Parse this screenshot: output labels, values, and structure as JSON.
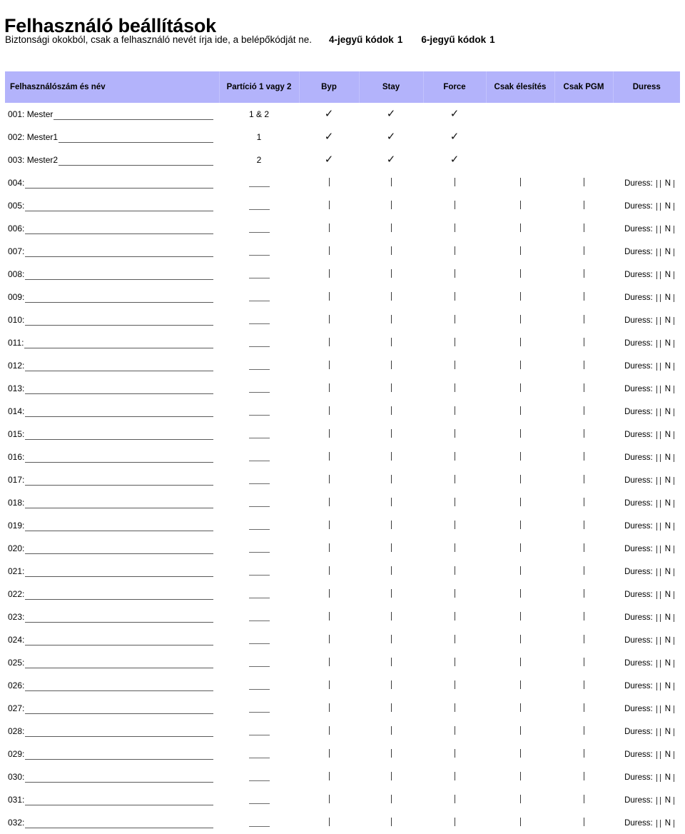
{
  "page": {
    "title": "Felhasználó beállítások",
    "note": "Biztonsági okokból, csak a felhasználó nevét írja ide, a belépőkódját ne.",
    "code4_label": "4-jegyű kódok",
    "code4_value": "1",
    "code6_label": "6-jegyű kódok",
    "code6_value": "1",
    "header_bg": "#b3b3fb",
    "background": "#ffffff",
    "text_color": "#000000"
  },
  "table": {
    "headers": [
      "Felhasználószám és név",
      "Partíció 1 vagy 2",
      "Byp",
      "Stay",
      "Force",
      "Csak élesítés",
      "Csak PGM",
      "Duress"
    ],
    "duress_label": "Duress:",
    "duress_n": "N",
    "check_glyph": "✓",
    "rows": [
      {
        "num": "001:",
        "name": "Mester",
        "partition": "1 & 2",
        "byp": "check",
        "stay": "check",
        "force": "check",
        "arm": "",
        "pgm": "",
        "duress": ""
      },
      {
        "num": "002:",
        "name": "Mester1",
        "partition": "1",
        "byp": "check",
        "stay": "check",
        "force": "check",
        "arm": "",
        "pgm": "",
        "duress": ""
      },
      {
        "num": "003:",
        "name": "Mester2",
        "partition": "2",
        "byp": "check",
        "stay": "check",
        "force": "check",
        "arm": "",
        "pgm": "",
        "duress": ""
      },
      {
        "num": "004:",
        "name": "",
        "partition": "blank",
        "byp": "tick",
        "stay": "tick",
        "force": "tick",
        "arm": "tick",
        "pgm": "tick",
        "duress": "duress"
      },
      {
        "num": "005:",
        "name": "",
        "partition": "blank",
        "byp": "tick",
        "stay": "tick",
        "force": "tick",
        "arm": "tick",
        "pgm": "tick",
        "duress": "duress"
      },
      {
        "num": "006:",
        "name": "",
        "partition": "blank",
        "byp": "tick",
        "stay": "tick",
        "force": "tick",
        "arm": "tick",
        "pgm": "tick",
        "duress": "duress"
      },
      {
        "num": "007:",
        "name": "",
        "partition": "blank",
        "byp": "tick",
        "stay": "tick",
        "force": "tick",
        "arm": "tick",
        "pgm": "tick",
        "duress": "duress"
      },
      {
        "num": "008:",
        "name": "",
        "partition": "blank",
        "byp": "tick",
        "stay": "tick",
        "force": "tick",
        "arm": "tick",
        "pgm": "tick",
        "duress": "duress"
      },
      {
        "num": "009:",
        "name": "",
        "partition": "blank",
        "byp": "tick",
        "stay": "tick",
        "force": "tick",
        "arm": "tick",
        "pgm": "tick",
        "duress": "duress"
      },
      {
        "num": "010:",
        "name": "",
        "partition": "blank",
        "byp": "tick",
        "stay": "tick",
        "force": "tick",
        "arm": "tick",
        "pgm": "tick",
        "duress": "duress"
      },
      {
        "num": "011:",
        "name": "",
        "partition": "blank",
        "byp": "tick",
        "stay": "tick",
        "force": "tick",
        "arm": "tick",
        "pgm": "tick",
        "duress": "duress"
      },
      {
        "num": "012:",
        "name": "",
        "partition": "blank",
        "byp": "tick",
        "stay": "tick",
        "force": "tick",
        "arm": "tick",
        "pgm": "tick",
        "duress": "duress"
      },
      {
        "num": "013:",
        "name": "",
        "partition": "blank",
        "byp": "tick",
        "stay": "tick",
        "force": "tick",
        "arm": "tick",
        "pgm": "tick",
        "duress": "duress"
      },
      {
        "num": "014:",
        "name": "",
        "partition": "blank",
        "byp": "tick",
        "stay": "tick",
        "force": "tick",
        "arm": "tick",
        "pgm": "tick",
        "duress": "duress"
      },
      {
        "num": "015:",
        "name": "",
        "partition": "blank",
        "byp": "tick",
        "stay": "tick",
        "force": "tick",
        "arm": "tick",
        "pgm": "tick",
        "duress": "duress"
      },
      {
        "num": "016:",
        "name": "",
        "partition": "blank",
        "byp": "tick",
        "stay": "tick",
        "force": "tick",
        "arm": "tick",
        "pgm": "tick",
        "duress": "duress"
      },
      {
        "num": "017:",
        "name": "",
        "partition": "blank",
        "byp": "tick",
        "stay": "tick",
        "force": "tick",
        "arm": "tick",
        "pgm": "tick",
        "duress": "duress"
      },
      {
        "num": "018:",
        "name": "",
        "partition": "blank",
        "byp": "tick",
        "stay": "tick",
        "force": "tick",
        "arm": "tick",
        "pgm": "tick",
        "duress": "duress"
      },
      {
        "num": "019:",
        "name": "",
        "partition": "blank",
        "byp": "tick",
        "stay": "tick",
        "force": "tick",
        "arm": "tick",
        "pgm": "tick",
        "duress": "duress"
      },
      {
        "num": "020:",
        "name": "",
        "partition": "blank",
        "byp": "tick",
        "stay": "tick",
        "force": "tick",
        "arm": "tick",
        "pgm": "tick",
        "duress": "duress"
      },
      {
        "num": "021:",
        "name": "",
        "partition": "blank",
        "byp": "tick",
        "stay": "tick",
        "force": "tick",
        "arm": "tick",
        "pgm": "tick",
        "duress": "duress"
      },
      {
        "num": "022:",
        "name": "",
        "partition": "blank",
        "byp": "tick",
        "stay": "tick",
        "force": "tick",
        "arm": "tick",
        "pgm": "tick",
        "duress": "duress"
      },
      {
        "num": "023:",
        "name": "",
        "partition": "blank",
        "byp": "tick",
        "stay": "tick",
        "force": "tick",
        "arm": "tick",
        "pgm": "tick",
        "duress": "duress"
      },
      {
        "num": "024:",
        "name": "",
        "partition": "blank",
        "byp": "tick",
        "stay": "tick",
        "force": "tick",
        "arm": "tick",
        "pgm": "tick",
        "duress": "duress"
      },
      {
        "num": "025:",
        "name": "",
        "partition": "blank",
        "byp": "tick",
        "stay": "tick",
        "force": "tick",
        "arm": "tick",
        "pgm": "tick",
        "duress": "duress"
      },
      {
        "num": "026:",
        "name": "",
        "partition": "blank",
        "byp": "tick",
        "stay": "tick",
        "force": "tick",
        "arm": "tick",
        "pgm": "tick",
        "duress": "duress"
      },
      {
        "num": "027:",
        "name": "",
        "partition": "blank",
        "byp": "tick",
        "stay": "tick",
        "force": "tick",
        "arm": "tick",
        "pgm": "tick",
        "duress": "duress"
      },
      {
        "num": "028:",
        "name": "",
        "partition": "blank",
        "byp": "tick",
        "stay": "tick",
        "force": "tick",
        "arm": "tick",
        "pgm": "tick",
        "duress": "duress"
      },
      {
        "num": "029:",
        "name": "",
        "partition": "blank",
        "byp": "tick",
        "stay": "tick",
        "force": "tick",
        "arm": "tick",
        "pgm": "tick",
        "duress": "duress"
      },
      {
        "num": "030:",
        "name": "",
        "partition": "blank",
        "byp": "tick",
        "stay": "tick",
        "force": "tick",
        "arm": "tick",
        "pgm": "tick",
        "duress": "duress"
      },
      {
        "num": "031:",
        "name": "",
        "partition": "blank",
        "byp": "tick",
        "stay": "tick",
        "force": "tick",
        "arm": "tick",
        "pgm": "tick",
        "duress": "duress"
      },
      {
        "num": "032:",
        "name": "",
        "partition": "blank",
        "byp": "tick",
        "stay": "tick",
        "force": "tick",
        "arm": "tick",
        "pgm": "tick",
        "duress": "duress"
      }
    ]
  }
}
